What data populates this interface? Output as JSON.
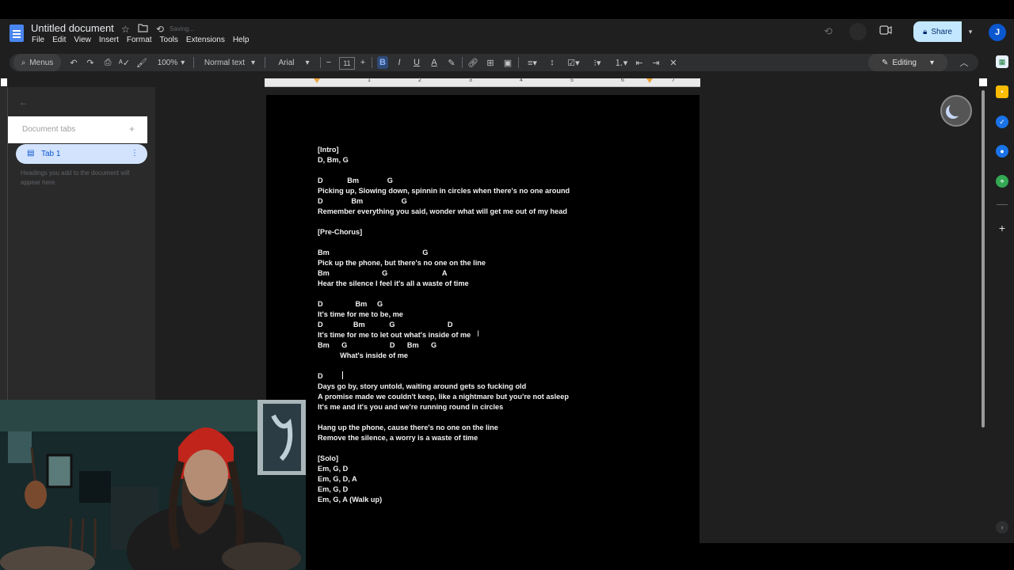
{
  "app": {
    "title": "Untitled document",
    "saving_status": "Saving...",
    "menu": [
      "File",
      "Edit",
      "View",
      "Insert",
      "Format",
      "Tools",
      "Extensions",
      "Help"
    ],
    "share_label": "Share",
    "avatar_initial": "J"
  },
  "toolbar": {
    "menus_label": "Menus",
    "zoom": "100%",
    "style": "Normal text",
    "font": "Arial",
    "font_size": "11",
    "editing_label": "Editing"
  },
  "ruler_numbers": [
    "1",
    "2",
    "3",
    "4",
    "5",
    "6",
    "7"
  ],
  "sidebar": {
    "header": "Document tabs",
    "add_symbol": "+",
    "tab_label": "Tab 1",
    "hint": "Headings you add to the document will appear here."
  },
  "document": {
    "lines": [
      "[Intro]",
      "D, Bm, G",
      "",
      "D            Bm              G",
      "Picking up, Slowing down, spinnin in circles when there's no one around",
      "D              Bm                   G",
      "Remember everything you said, wonder what will get me out of my head",
      "",
      "[Pre-Chorus]",
      "",
      "Bm                                              G",
      "Pick up the phone, but there's no one on the line",
      "Bm                          G                           A",
      "Hear the silence I feel it's all a waste of time",
      "",
      "D                Bm     G",
      "It's time for me to be, me",
      "D               Bm            G                          D",
      "It's time for me to let out what's inside of me",
      "Bm      G                     D      Bm      G",
      "           What's inside of me",
      "",
      "D",
      "Days go by, story untold, waiting around gets so fucking old",
      "A promise made we couldn't keep, like a nightmare but you're not asleep",
      "It's me and it's you and we're running round in circles",
      "",
      "Hang up the phone, cause there's no one on the line",
      "Remove the silence, a worry is a waste of time",
      "",
      "[Solo]",
      "Em, G, D",
      "Em, G, D, A",
      "Em, G, D",
      "Em, G, A (Walk up)"
    ]
  },
  "colors": {
    "accent": "#c2e7ff",
    "tab_bg": "#d3e3fd",
    "page": "#000000",
    "workspace": "#1f1f1f"
  }
}
